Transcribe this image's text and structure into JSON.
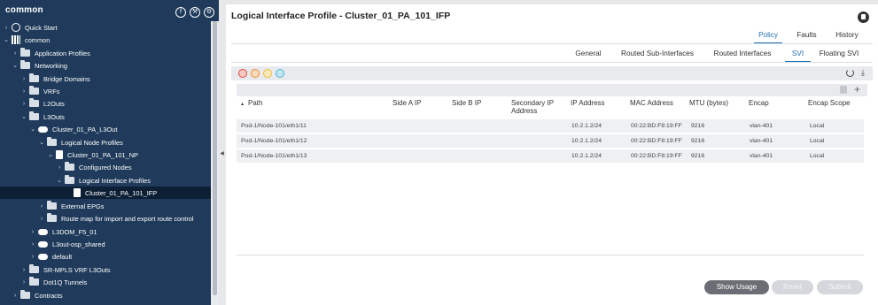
{
  "sidebar": {
    "title": "common",
    "header_icons": [
      "f-circle-icon",
      "tools-circle-icon",
      "gear-circle-icon"
    ],
    "tree": [
      {
        "label": "Quick Start",
        "icon": "quickstart",
        "chev": "›"
      },
      {
        "label": "common",
        "icon": "tenant",
        "chev": "⌄"
      },
      {
        "label": "Application Profiles",
        "icon": "folder",
        "chev": "›"
      },
      {
        "label": "Networking",
        "icon": "folder",
        "chev": "⌄"
      },
      {
        "label": "Bridge Domains",
        "icon": "folder",
        "chev": "›"
      },
      {
        "label": "VRFs",
        "icon": "folder",
        "chev": "›"
      },
      {
        "label": "L2Outs",
        "icon": "folder",
        "chev": "›"
      },
      {
        "label": "L3Outs",
        "icon": "folder",
        "chev": "⌄"
      },
      {
        "label": "Cluster_01_PA_L3Out",
        "icon": "cloud",
        "chev": "⌄"
      },
      {
        "label": "Logical Node Profiles",
        "icon": "folder",
        "chev": "⌄"
      },
      {
        "label": "Cluster_01_PA_101_NP",
        "icon": "doc",
        "chev": "⌄"
      },
      {
        "label": "Configured Nodes",
        "icon": "folder",
        "chev": "›"
      },
      {
        "label": "Logical Interface Profiles",
        "icon": "folder",
        "chev": "⌄"
      },
      {
        "label": "Cluster_01_PA_101_IFP",
        "icon": "doc",
        "chev": ""
      },
      {
        "label": "External EPGs",
        "icon": "folder",
        "chev": "›"
      },
      {
        "label": "Route map for import and export route control",
        "icon": "folder",
        "chev": "›"
      },
      {
        "label": "L3DOM_F5_01",
        "icon": "cloud",
        "chev": "›"
      },
      {
        "label": "L3out-osp_shared",
        "icon": "cloud",
        "chev": "›"
      },
      {
        "label": "default",
        "icon": "cloud",
        "chev": "›"
      },
      {
        "label": "SR-MPLS VRF L3Outs",
        "icon": "folder",
        "chev": "›"
      },
      {
        "label": "Dot1Q Tunnels",
        "icon": "folder",
        "chev": "›"
      },
      {
        "label": "Contracts",
        "icon": "folder",
        "chev": "›"
      }
    ]
  },
  "main": {
    "title": "Logical Interface Profile - Cluster_01_PA_101_IFP",
    "tabs": [
      "Policy",
      "Faults",
      "History"
    ],
    "active_tab": "Policy",
    "subtabs": [
      "General",
      "Routed Sub-Interfaces",
      "Routed Interfaces",
      "SVI",
      "Floating SVI"
    ],
    "active_subtab": "SVI",
    "table": {
      "sort_indicator": "▴",
      "columns": [
        "Path",
        "Side A IP",
        "Side B IP",
        "Secondary IP Address",
        "IP Address",
        "MAC Address",
        "MTU (bytes)",
        "Encap",
        "Encap Scope"
      ],
      "rows": [
        [
          "Pod-1/Node-101/eth1/11",
          "",
          "",
          "",
          "10.2.1.2/24",
          "00:22:BD:F8:19:FF",
          "9216",
          "vlan-401",
          "Local"
        ],
        [
          "Pod-1/Node-101/eth1/12",
          "",
          "",
          "",
          "10.2.1.2/24",
          "00:22:BD:F8:19:FF",
          "9216",
          "vlan-401",
          "Local"
        ],
        [
          "Pod-1/Node-101/eth1/13",
          "",
          "",
          "",
          "10.2.1.2/24",
          "00:22:BD:F8:19:FF",
          "9216",
          "vlan-401",
          "Local"
        ]
      ]
    },
    "buttons": {
      "show_usage": "Show Usage",
      "reset": "Reset",
      "submit": "Submit"
    },
    "fault_colors": [
      "#e2473d",
      "#f08a2c",
      "#f2c037",
      "#49b5d6"
    ],
    "accent_color": "#1f6fb2"
  }
}
